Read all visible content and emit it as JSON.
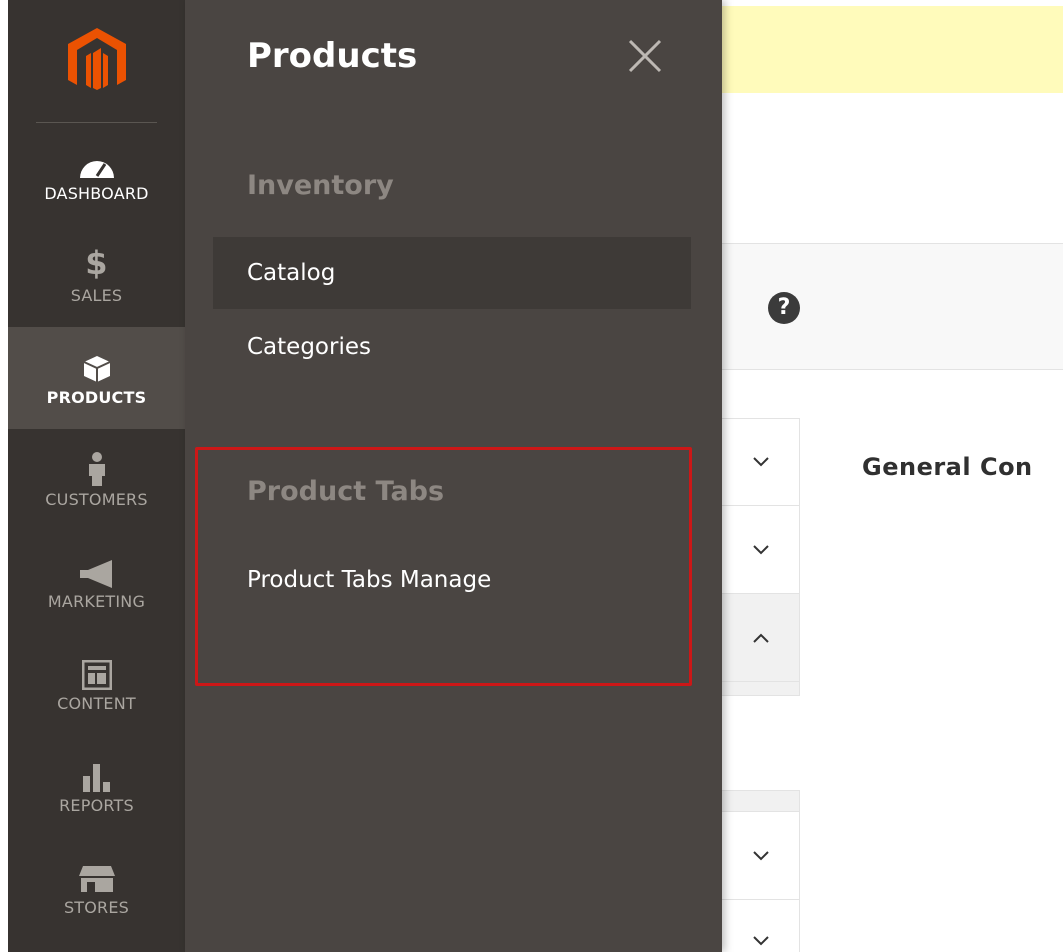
{
  "nav": {
    "items": [
      {
        "label": "DASHBOARD",
        "icon": "dashboard-icon"
      },
      {
        "label": "SALES",
        "icon": "dollar-icon"
      },
      {
        "label": "PRODUCTS",
        "icon": "box-icon"
      },
      {
        "label": "CUSTOMERS",
        "icon": "person-icon"
      },
      {
        "label": "MARKETING",
        "icon": "megaphone-icon"
      },
      {
        "label": "CONTENT",
        "icon": "layout-icon"
      },
      {
        "label": "REPORTS",
        "icon": "bar-chart-icon"
      },
      {
        "label": "STORES",
        "icon": "storefront-icon"
      }
    ]
  },
  "submenu": {
    "title": "Products",
    "groups": [
      {
        "title": "Inventory",
        "links": [
          "Catalog",
          "Categories"
        ]
      },
      {
        "title": "Product Tabs",
        "links": [
          "Product Tabs Manage"
        ]
      }
    ]
  },
  "content": {
    "help_symbol": "?",
    "section_title": "General Con"
  },
  "colors": {
    "nav_bg": "#373330",
    "submenu_bg": "#4a4542",
    "logo_orange": "#eb5202",
    "highlight_red": "#cc1717",
    "notice_yellow": "#fffbbb"
  }
}
